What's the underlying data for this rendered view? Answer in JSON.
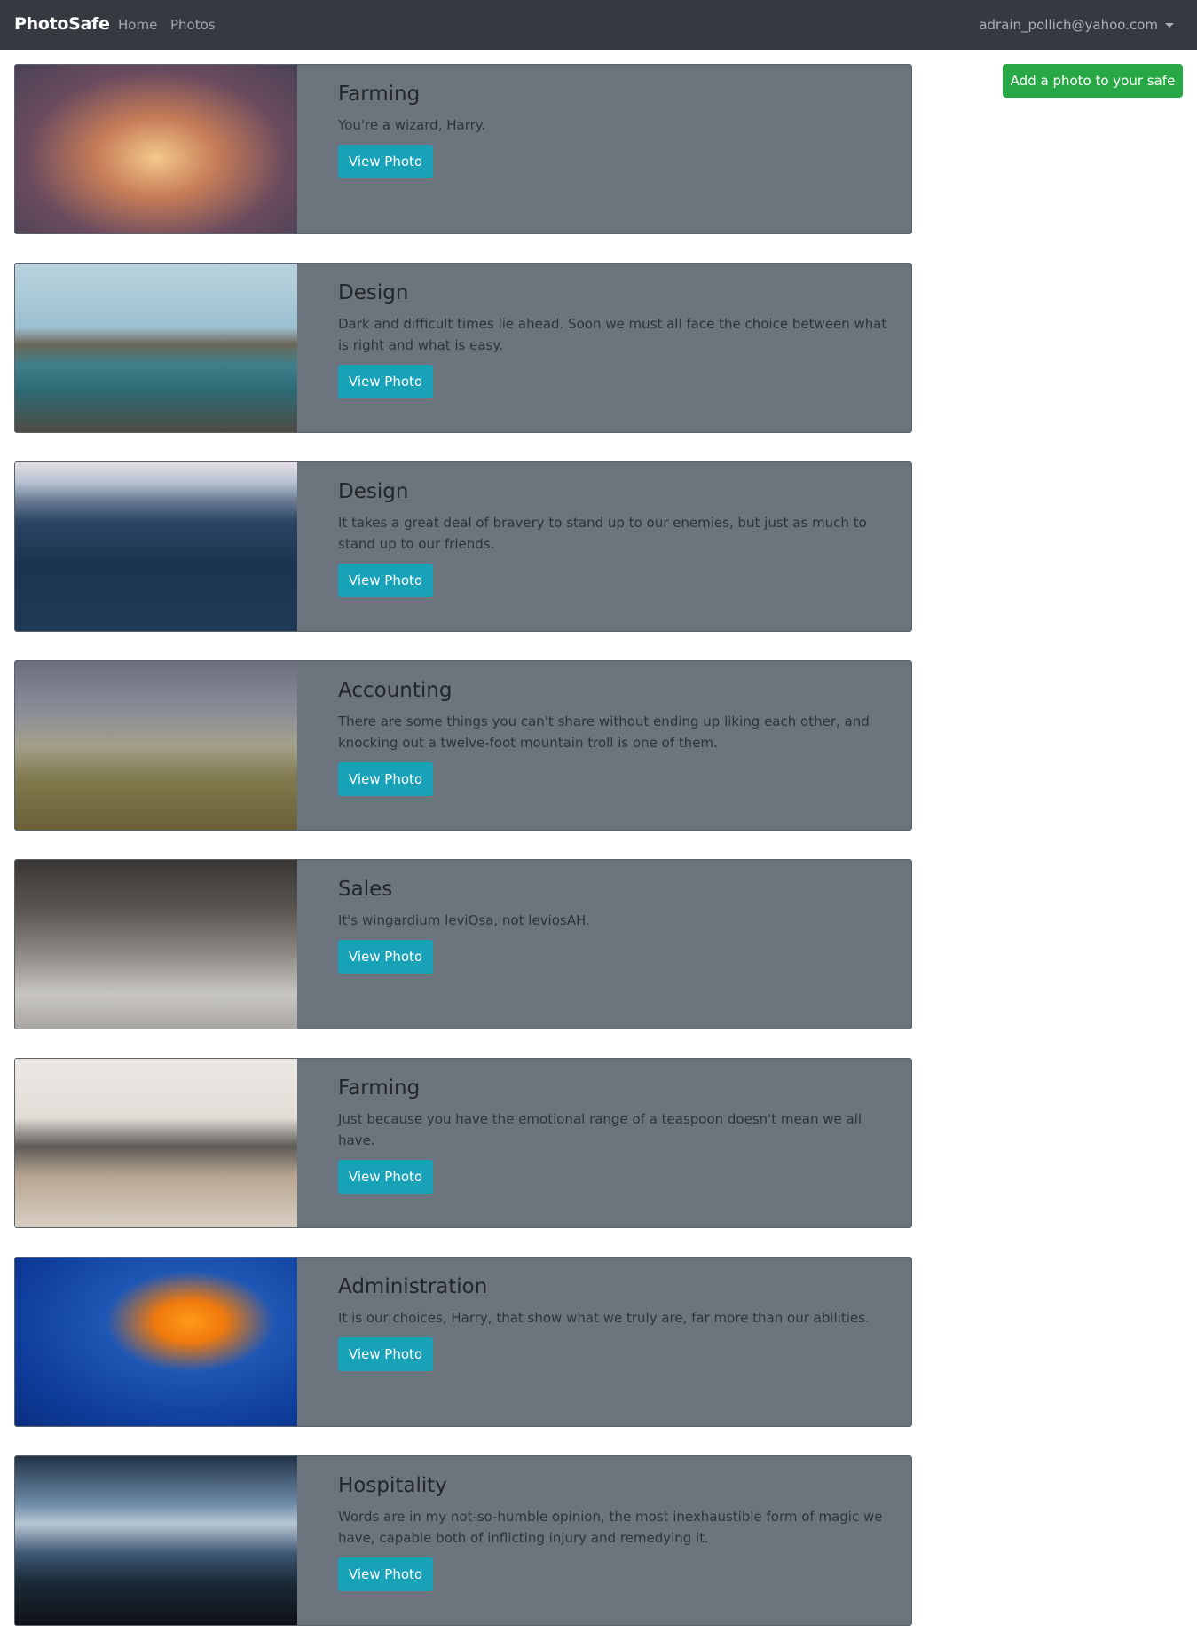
{
  "navbar": {
    "brand": "PhotoSafe",
    "links": [
      "Home",
      "Photos"
    ],
    "user_email": "adrain_pollich@yahoo.com"
  },
  "actions": {
    "add_photo_label": "Add a photo to your safe"
  },
  "colors": {
    "navbar": "#343a40",
    "card": "#6c757d",
    "view_button": "#17a2b8",
    "add_button": "#28a745"
  },
  "photos": [
    {
      "title": "Farming",
      "description": "You're a wizard, Harry.",
      "button": "View Photo"
    },
    {
      "title": "Design",
      "description": "Dark and difficult times lie ahead. Soon we must all face the choice between what is right and what is easy.",
      "button": "View Photo"
    },
    {
      "title": "Design",
      "description": "It takes a great deal of bravery to stand up to our enemies, but just as much to stand up to our friends.",
      "button": "View Photo"
    },
    {
      "title": "Accounting",
      "description": "There are some things you can't share without ending up liking each other, and knocking out a twelve-foot mountain troll is one of them.",
      "button": "View Photo"
    },
    {
      "title": "Sales",
      "description": "It's wingardium leviOsa, not leviosAH.",
      "button": "View Photo"
    },
    {
      "title": "Farming",
      "description": "Just because you have the emotional range of a teaspoon doesn't mean we all have.",
      "button": "View Photo"
    },
    {
      "title": "Administration",
      "description": "It is our choices, Harry, that show what we truly are, far more than our abilities.",
      "button": "View Photo"
    },
    {
      "title": "Hospitality",
      "description": "Words are in my not-so-humble opinion, the most inexhaustible form of magic we have, capable both of inflicting injury and remedying it.",
      "button": "View Photo"
    }
  ]
}
